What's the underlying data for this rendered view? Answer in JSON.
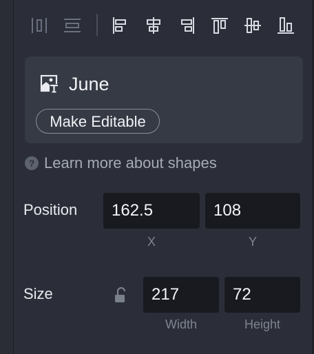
{
  "toolbar": {
    "tools": [
      {
        "name": "distribute-horizontal-icon"
      },
      {
        "name": "distribute-vertical-icon"
      },
      {
        "name": "align-left-icon"
      },
      {
        "name": "align-center-horizontal-icon"
      },
      {
        "name": "align-right-icon"
      },
      {
        "name": "align-top-icon"
      },
      {
        "name": "align-middle-vertical-icon"
      },
      {
        "name": "align-bottom-icon"
      }
    ]
  },
  "element": {
    "icon": "image-text-icon",
    "name": "June",
    "make_editable_label": "Make Editable"
  },
  "help": {
    "label": "Learn more about shapes",
    "icon": "?"
  },
  "position": {
    "label": "Position",
    "x": "162.5",
    "y": "108",
    "x_caption": "X",
    "y_caption": "Y"
  },
  "size": {
    "label": "Size",
    "width": "217",
    "height": "72",
    "width_caption": "Width",
    "height_caption": "Height",
    "lock_icon": "unlocked-icon"
  },
  "colors": {
    "panel_bg": "#2b2e38",
    "card_bg": "#363a45",
    "field_bg": "#181a20",
    "text": "#e9ebf0",
    "muted": "#7f8492"
  }
}
